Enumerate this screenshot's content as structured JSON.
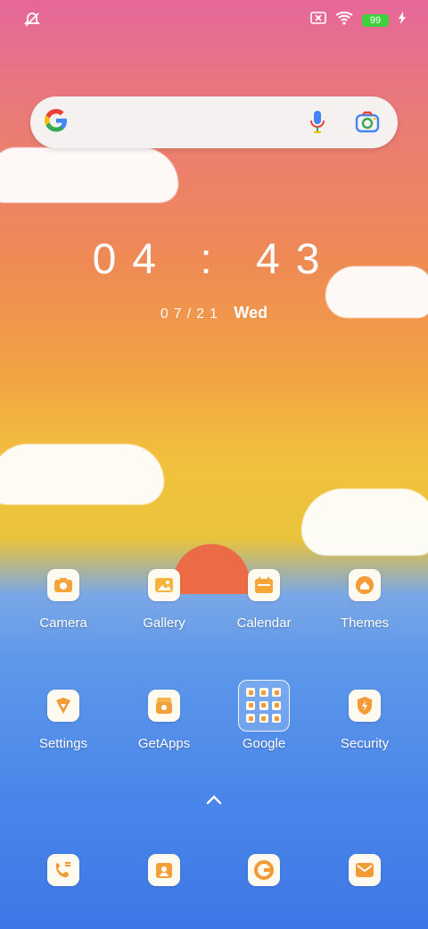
{
  "status_bar": {
    "battery": "99"
  },
  "search_widget": {
    "google_icon": "google-logo",
    "mic_icon": "microphone",
    "lens_icon": "camera-lens"
  },
  "clock": {
    "time": "04 : 43",
    "date": "07/21",
    "day": "Wed"
  },
  "apps": [
    {
      "label": "Camera",
      "icon": "camera"
    },
    {
      "label": "Gallery",
      "icon": "gallery"
    },
    {
      "label": "Calendar",
      "icon": "calendar"
    },
    {
      "label": "Themes",
      "icon": "themes"
    },
    {
      "label": "Settings",
      "icon": "settings"
    },
    {
      "label": "GetApps",
      "icon": "store"
    },
    {
      "label": "Google",
      "icon": "folder"
    },
    {
      "label": "Security",
      "icon": "security"
    }
  ],
  "dock": [
    {
      "icon": "phone"
    },
    {
      "icon": "contacts"
    },
    {
      "icon": "browser"
    },
    {
      "icon": "messages"
    }
  ]
}
